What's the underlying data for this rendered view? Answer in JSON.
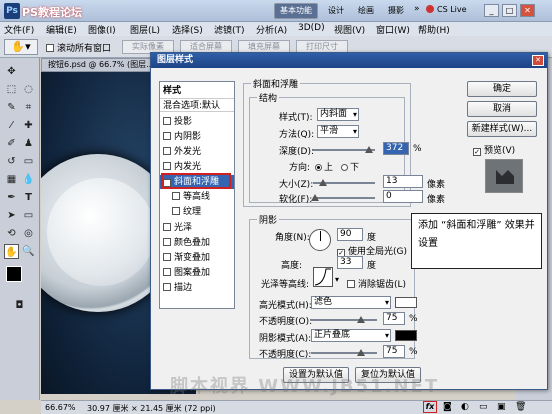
{
  "titlebar": {
    "logo": "Ps",
    "watermark_top": "PS教程论坛",
    "workspace_label": "基本功能",
    "tabs": [
      "设计",
      "绘画",
      "摄影"
    ],
    "more": "»",
    "cslive": "CS Live"
  },
  "menubar": {
    "items": [
      "文件(F)",
      "编辑(E)",
      "图像(I)",
      "图层(L)",
      "选择(S)",
      "滤镜(T)",
      "分析(A)",
      "3D(D)",
      "视图(V)",
      "窗口(W)",
      "帮助(H)"
    ]
  },
  "options_bar": {
    "scroll_all_label": "滚动所有窗口",
    "buttons": [
      "实际像素",
      "适合屏幕",
      "填充屏幕",
      "打印尺寸"
    ]
  },
  "document": {
    "tab": "按钮6.psd @ 66.7% (图层...",
    "zoom": "66.67%",
    "size": "30.97 厘米 × 21.45 厘米 (72 ppi)"
  },
  "dialog": {
    "title": "图层样式",
    "styles_header": "样式",
    "blend_options": "混合选项:默认",
    "style_items": [
      {
        "label": "投影",
        "checked": false
      },
      {
        "label": "内阴影",
        "checked": false
      },
      {
        "label": "外发光",
        "checked": false
      },
      {
        "label": "内发光",
        "checked": false
      },
      {
        "label": "斜面和浮雕",
        "checked": true
      },
      {
        "label": "等高线",
        "checked": false
      },
      {
        "label": "纹理",
        "checked": false
      },
      {
        "label": "光泽",
        "checked": false
      },
      {
        "label": "颜色叠加",
        "checked": false
      },
      {
        "label": "渐变叠加",
        "checked": false
      },
      {
        "label": "图案叠加",
        "checked": false
      },
      {
        "label": "描边",
        "checked": false
      }
    ],
    "bevel_group_title": "斜面和浮雕",
    "structure_title": "结构",
    "style_label": "样式(T):",
    "style_value": "内斜面",
    "method_label": "方法(Q):",
    "method_value": "平滑",
    "depth_label": "深度(D):",
    "depth_value": "372",
    "percent": "%",
    "direction_label": "方向:",
    "direction_up": "上",
    "direction_down": "下",
    "size_label": "大小(Z):",
    "size_value": "13",
    "soften_label": "软化(F):",
    "soften_value": "0",
    "px": "像素",
    "shading_title": "阴影",
    "angle_label": "角度(N):",
    "angle_value": "90",
    "degree": "度",
    "global_light_label": "使用全局光(G)",
    "altitude_label": "高度:",
    "altitude_value": "33",
    "gloss_contour_label": "光泽等高线:",
    "anti_alias_label": "消除锯齿(L)",
    "highlight_mode_label": "高光模式(H):",
    "highlight_mode_value": "滤色",
    "highlight_opacity_label": "不透明度(O):",
    "highlight_opacity_value": "75",
    "shadow_mode_label": "阴影模式(A):",
    "shadow_mode_value": "正片叠底",
    "shadow_opacity_label": "不透明度(C):",
    "shadow_opacity_value": "75",
    "make_default": "设置为默认值",
    "reset_default": "复位为默认值",
    "ok": "确定",
    "cancel": "取消",
    "new_style": "新建样式(W)...",
    "preview_label": "预览(V)",
    "close_glyph": "✕"
  },
  "callout": {
    "text": "添加 “斜面和浮雕” 效果并设置"
  },
  "watermark_bottom": "脚本视界  WWW.JB51.NET",
  "colors": {
    "accent_red": "#d02020",
    "title_blue": "#1d4386",
    "highlight_swatch": "#ffffff",
    "shadow_swatch": "#000000"
  }
}
